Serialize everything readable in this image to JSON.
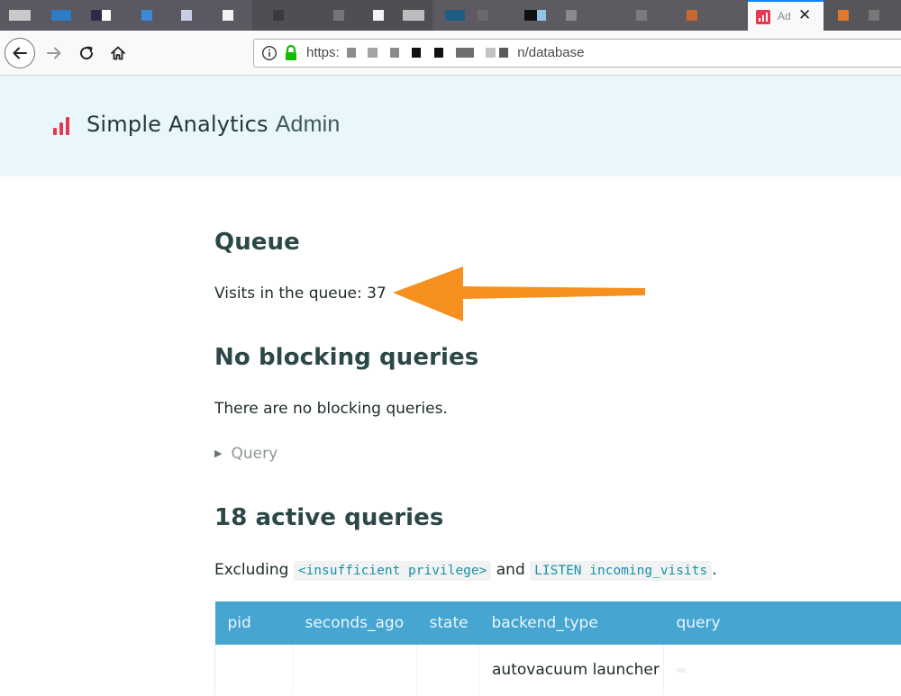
{
  "browser": {
    "active_tab_title": "Ad",
    "url_scheme": "https:",
    "url_path_visible": "n/database",
    "colors": {
      "tab_accent": "#0a84ff",
      "lock": "#12bc00"
    }
  },
  "site": {
    "brand_name": "Simple Analytics",
    "brand_suffix": "Admin",
    "logo_icon": "bar-chart-icon",
    "colors": {
      "brand_red": "#e8384f",
      "header_bg": "#e9f6fc",
      "table_header": "#46a6d1",
      "annotation_arrow": "#f5901e"
    }
  },
  "queue": {
    "heading": "Queue",
    "label": "Visits in the queue:",
    "count": "37"
  },
  "blocking": {
    "heading": "No blocking queries",
    "message": "There are no blocking queries.",
    "details_label": "Query"
  },
  "active": {
    "heading": "18 active queries",
    "excluding_prefix": "Excluding",
    "code_1": "<insufficient privilege>",
    "conjunction": "and",
    "code_2": "LISTEN incoming_visits",
    "suffix": "."
  },
  "table": {
    "columns": [
      "pid",
      "seconds_ago",
      "state",
      "backend_type",
      "query"
    ],
    "rows": [
      {
        "pid": "",
        "seconds_ago": "",
        "state": "",
        "backend_type": "autovacuum launcher",
        "query": ""
      }
    ]
  }
}
